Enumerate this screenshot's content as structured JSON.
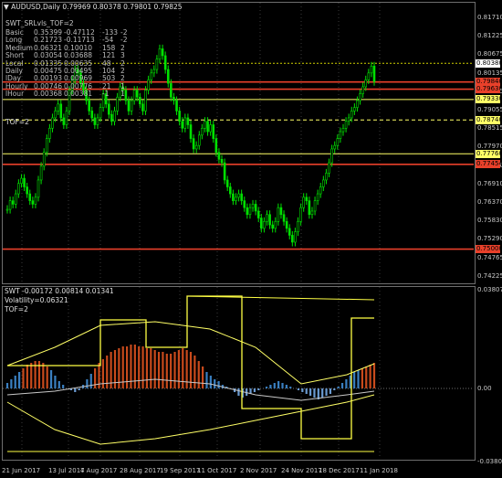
{
  "window": {
    "title": "AUDUSD,Daily",
    "ohlc": "0.79969 0.80378 0.79801 0.79825"
  },
  "indicator_main": {
    "title": "SWT_SRLvls_TOF=2",
    "tof": "TOF=2"
  },
  "levels_table": {
    "rows": [
      {
        "name": "Basic",
        "a": "0.35399",
        "b": "-0.47112",
        "c": "-133",
        "d": "-2"
      },
      {
        "name": "Long",
        "a": "0.21723",
        "b": "-0.11713",
        "c": "-54",
        "d": "-2"
      },
      {
        "name": "Medium",
        "a": "0.06321",
        "b": "0.10010",
        "c": "158",
        "d": "2"
      },
      {
        "name": "Short",
        "a": "0.03054",
        "b": "0.03688",
        "c": "121",
        "d": "3"
      },
      {
        "name": "Local",
        "a": "0.01335",
        "b": "0.00635",
        "c": "48",
        "d": "2"
      },
      {
        "name": "Daily",
        "a": "0.00475",
        "b": "0.00495",
        "c": "104",
        "d": "2"
      },
      {
        "name": "lDay",
        "a": "0.00193",
        "b": "0.00969",
        "c": "503",
        "d": "2"
      },
      {
        "name": "Hourly",
        "a": "0.00746",
        "b": "0.00776",
        "c": "21",
        "d": "1"
      },
      {
        "name": "lHour",
        "a": "0.00368",
        "b": "0.00381",
        "c": "-1",
        "d": "1"
      }
    ]
  },
  "price_axis": {
    "ticks": [
      "0.81710",
      "0.81225",
      "0.80675",
      "0.80135",
      "0.79595",
      "0.79055",
      "0.78515",
      "0.77970",
      "0.77430",
      "0.76910",
      "0.76370",
      "0.75830",
      "0.75290",
      "0.74765",
      "0.74225"
    ]
  },
  "price_boxes": [
    {
      "value": "0.80380",
      "bg": "#ffffff"
    },
    {
      "value": "0.79840",
      "bg": "#e8402a"
    },
    {
      "value": "0.79630",
      "bg": "#e8402a"
    },
    {
      "value": "0.79330",
      "bg": "#ffff66"
    },
    {
      "value": "0.78740",
      "bg": "#ffff66"
    },
    {
      "value": "0.77760",
      "bg": "#ffff66"
    },
    {
      "value": "0.77454",
      "bg": "#e8402a"
    },
    {
      "value": "0.75000",
      "bg": "#e8402a"
    }
  ],
  "sub_window": {
    "title": "SWT -0.00172 0.00814 0.01341",
    "volatility": "Volatility=0.06321",
    "tof": "TOF=2",
    "ticks": [
      "0.03807",
      "0.00",
      "-0.03807"
    ]
  },
  "time_axis": {
    "labels": [
      "21 Jun 2017",
      "13 Jul 2017",
      "4 Aug 2017",
      "28 Aug 2017",
      "19 Sep 2017",
      "11 Oct 2017",
      "2 Nov 2017",
      "24 Nov 2017",
      "18 Dec 2017",
      "11 Jan 2018"
    ]
  },
  "colors": {
    "bull": "#00e000",
    "bear": "#00e000",
    "support": "#e8402a",
    "resistance": "#ffff66",
    "grid": "#6e6e6e"
  }
}
